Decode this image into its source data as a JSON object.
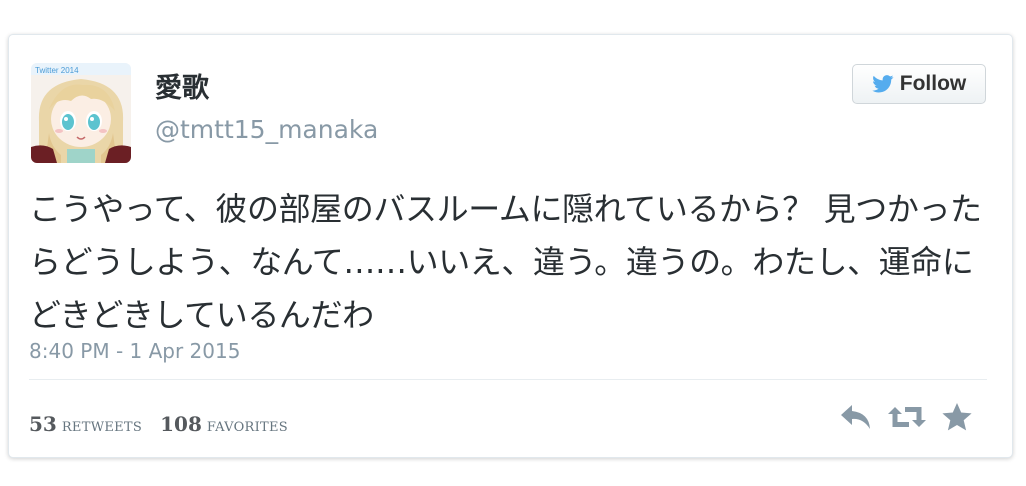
{
  "author": {
    "display_name": "愛歌",
    "handle": "@tmtt15_manaka",
    "avatar_icon": "anime-girl-avatar-icon",
    "avatar_badge": "Twitter 2014"
  },
  "follow": {
    "label": "Follow",
    "icon": "twitter-bird-icon",
    "icon_color": "#55acee"
  },
  "tweet": {
    "text": "こうやって、彼の部屋のバスルームに隠れているから？ 見つかったらどうしよう、なんて……いいえ、違う。違うの。わたし、運命にどきどきしているんだわ",
    "timestamp": "8:40 PM - 1 Apr 2015"
  },
  "stats": {
    "retweets_count": "53",
    "retweets_label": "RETWEETS",
    "favorites_count": "108",
    "favorites_label": "FAVORITES"
  },
  "actions": {
    "reply_icon": "reply-icon",
    "retweet_icon": "retweet-icon",
    "favorite_icon": "star-icon",
    "icon_color": "#8899a6"
  }
}
